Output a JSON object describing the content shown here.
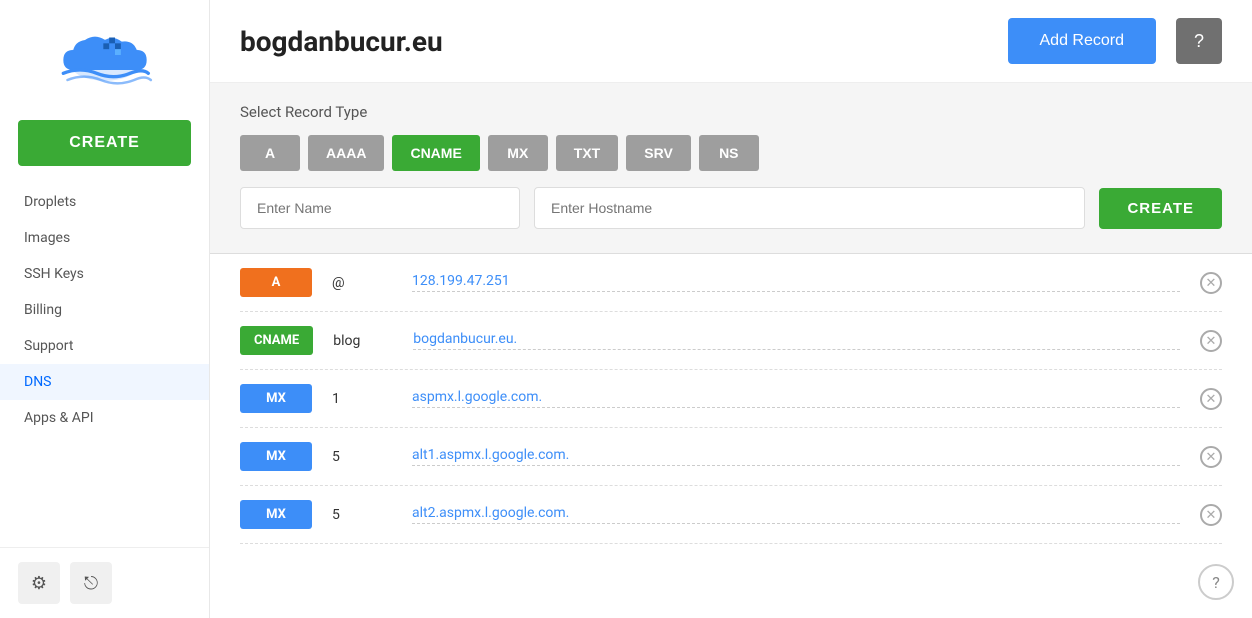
{
  "sidebar": {
    "create_label": "CREATE",
    "nav_items": [
      {
        "label": "Droplets",
        "id": "droplets",
        "active": false
      },
      {
        "label": "Images",
        "id": "images",
        "active": false
      },
      {
        "label": "SSH Keys",
        "id": "ssh-keys",
        "active": false
      },
      {
        "label": "Billing",
        "id": "billing",
        "active": false
      },
      {
        "label": "Support",
        "id": "support",
        "active": false
      },
      {
        "label": "DNS",
        "id": "dns",
        "active": true
      },
      {
        "label": "Apps & API",
        "id": "apps-api",
        "active": false
      }
    ],
    "gear_icon": "⚙",
    "logout_icon": "⎋"
  },
  "header": {
    "domain": "bogdanbucur.eu",
    "add_record_label": "Add Record",
    "help_icon": "?"
  },
  "form": {
    "select_label": "Select Record Type",
    "record_types": [
      {
        "label": "A",
        "active": false
      },
      {
        "label": "AAAA",
        "active": false
      },
      {
        "label": "CNAME",
        "active": true
      },
      {
        "label": "MX",
        "active": false
      },
      {
        "label": "TXT",
        "active": false
      },
      {
        "label": "SRV",
        "active": false
      },
      {
        "label": "NS",
        "active": false
      }
    ],
    "name_placeholder": "Enter Name",
    "hostname_placeholder": "Enter Hostname",
    "create_label": "CREATE"
  },
  "records": [
    {
      "type": "A",
      "badge_class": "badge-a",
      "name": "@",
      "value": "128.199.47.251"
    },
    {
      "type": "CNAME",
      "badge_class": "badge-cname",
      "name": "blog",
      "value": "bogdanbucur.eu."
    },
    {
      "type": "MX",
      "badge_class": "badge-mx",
      "name": "1",
      "value": "aspmx.l.google.com."
    },
    {
      "type": "MX",
      "badge_class": "badge-mx",
      "name": "5",
      "value": "alt1.aspmx.l.google.com."
    },
    {
      "type": "MX",
      "badge_class": "badge-mx",
      "name": "5",
      "value": "alt2.aspmx.l.google.com."
    }
  ],
  "help_bottom": "?"
}
